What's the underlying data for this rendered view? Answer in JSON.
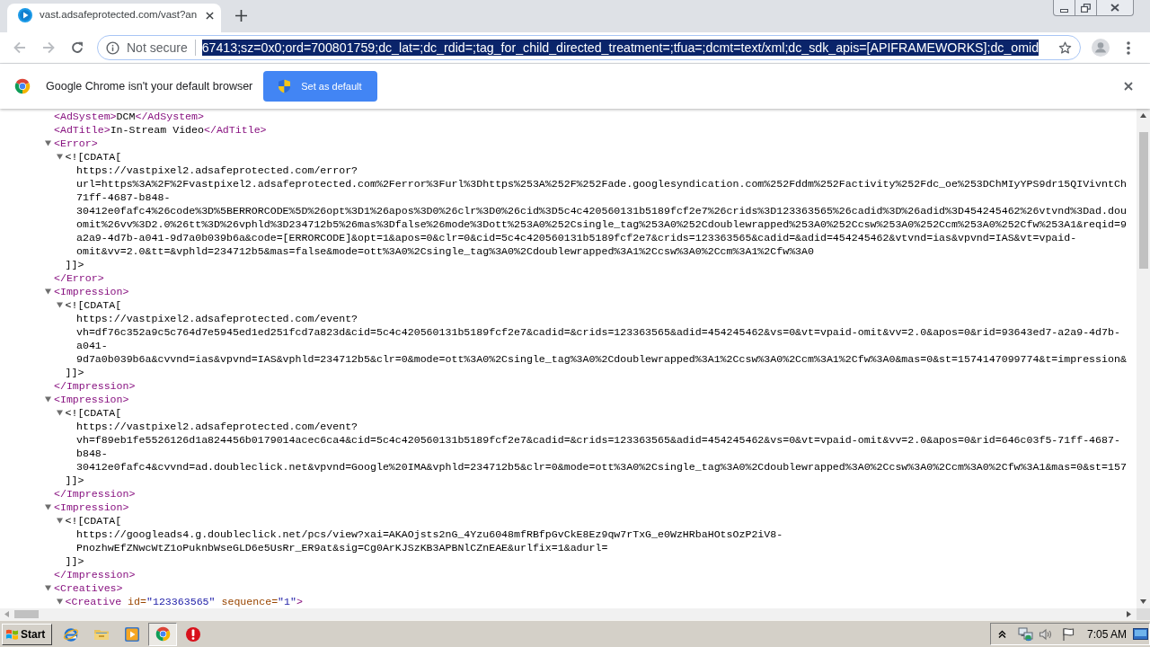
{
  "tabs": [
    {
      "title": "vast.adsafeprotected.com/vast?an",
      "selected": true
    }
  ],
  "toolbar": {
    "nav_buttons": [
      {
        "kind": "back",
        "disabled": true
      },
      {
        "kind": "forward",
        "disabled": true
      },
      {
        "kind": "reload",
        "disabled": false
      }
    ],
    "security_label": "Not secure",
    "address": {
      "value": "67413;sz=0x0;ord=700801759;dc_lat=;dc_rdid=;tag_for_child_directed_treatment=;tfua=;dcmt=text/xml;dc_sdk_apis=[APIFRAMEWORKS];dc_omid",
      "selected": true
    }
  },
  "infobar": {
    "message": "Google Chrome isn't your default browser",
    "button": "Set as default"
  },
  "document": {
    "nodes": [
      {
        "tokens": [
          {
            "kind": "tag",
            "text": "<AdSystem>"
          },
          {
            "kind": "text",
            "text": "DCM"
          },
          {
            "kind": "tag",
            "text": "</AdSystem>"
          }
        ]
      },
      {
        "tokens": [
          {
            "kind": "tag",
            "text": "<AdTitle>"
          },
          {
            "kind": "text",
            "text": "In-Stream Video"
          },
          {
            "kind": "tag",
            "text": "</AdTitle>"
          }
        ]
      },
      {
        "open": [
          {
            "kind": "tag",
            "text": "<Error>"
          }
        ],
        "expanded": true,
        "children": [
          {
            "open": [
              {
                "kind": "text",
                "text": "<![CDATA["
              }
            ],
            "expanded": true,
            "children": [
              {
                "text": "https://vastpixel2.adsafeprotected.com/error?"
              },
              {
                "text": "url=https%3A%2F%2Fvastpixel2.adsafeprotected.com%2Ferror%3Furl%3Dhttps%253A%252F%252Fade.googlesyndication.com%252Fddm%252Factivity%252Fdc_oe%253DChMIyYPS9dr15QIVivntCh"
              },
              {
                "text": "71ff-4687-b848-"
              },
              {
                "text": "30412e0fafc4%26code%3D%5BERRORCODE%5D%26opt%3D1%26apos%3D0%26clr%3D0%26cid%3D5c4c420560131b5189fcf2e7%26crids%3D123363565%26cadid%3D%26adid%3D454245462%26vtvnd%3Dad.dou"
              },
              {
                "text": "omit%26vv%3D2.0%26tt%3D%26vphld%3D234712b5%26mas%3Dfalse%26mode%3Dott%253A0%252Csingle_tag%253A0%252Cdoublewrapped%253A0%252Ccsw%253A0%252Ccm%253A0%252Cfw%253A1&reqid=9"
              },
              {
                "text": "a2a9-4d7b-a041-9d7a0b039b6a&code=[ERRORCODE]&opt=1&apos=0&clr=0&cid=5c4c420560131b5189fcf2e7&crids=123363565&cadid=&adid=454245462&vtvnd=ias&vpvnd=IAS&vt=vpaid-"
              },
              {
                "text": "omit&vv=2.0&tt=&vphld=234712b5&mas=false&mode=ott%3A0%2Csingle_tag%3A0%2Cdoublewrapped%3A1%2Ccsw%3A0%2Ccm%3A1%2Cfw%3A0"
              }
            ],
            "close": [
              {
                "kind": "text",
                "text": "]]>"
              }
            ]
          }
        ],
        "close": [
          {
            "kind": "tag",
            "text": "</Error>"
          }
        ]
      },
      {
        "open": [
          {
            "kind": "tag",
            "text": "<Impression>"
          }
        ],
        "expanded": true,
        "children": [
          {
            "open": [
              {
                "kind": "text",
                "text": "<![CDATA["
              }
            ],
            "expanded": true,
            "children": [
              {
                "text": "https://vastpixel2.adsafeprotected.com/event?"
              },
              {
                "text": "vh=df76c352a9c5c764d7e5945ed1ed251fcd7a823d&cid=5c4c420560131b5189fcf2e7&cadid=&crids=123363565&adid=454245462&vs=0&vt=vpaid-omit&vv=2.0&apos=0&rid=93643ed7-a2a9-4d7b-"
              },
              {
                "text": "a041-"
              },
              {
                "text": "9d7a0b039b6a&cvvnd=ias&vpvnd=IAS&vphld=234712b5&clr=0&mode=ott%3A0%2Csingle_tag%3A0%2Cdoublewrapped%3A1%2Ccsw%3A0%2Ccm%3A1%2Cfw%3A0&mas=0&st=1574147099774&t=impression&"
              }
            ],
            "close": [
              {
                "kind": "text",
                "text": "]]>"
              }
            ]
          }
        ],
        "close": [
          {
            "kind": "tag",
            "text": "</Impression>"
          }
        ]
      },
      {
        "open": [
          {
            "kind": "tag",
            "text": "<Impression>"
          }
        ],
        "expanded": true,
        "children": [
          {
            "open": [
              {
                "kind": "text",
                "text": "<![CDATA["
              }
            ],
            "expanded": true,
            "children": [
              {
                "text": "https://vastpixel2.adsafeprotected.com/event?"
              },
              {
                "text": "vh=f89eb1fe5526126d1a824456b0179014acec6ca4&cid=5c4c420560131b5189fcf2e7&cadid=&crids=123363565&adid=454245462&vs=0&vt=vpaid-omit&vv=2.0&apos=0&rid=646c03f5-71ff-4687-"
              },
              {
                "text": "b848-"
              },
              {
                "text": "30412e0fafc4&cvvnd=ad.doubleclick.net&vpvnd=Google%20IMA&vphld=234712b5&clr=0&mode=ott%3A0%2Csingle_tag%3A0%2Cdoublewrapped%3A0%2Ccsw%3A0%2Ccm%3A0%2Cfw%3A1&mas=0&st=157"
              }
            ],
            "close": [
              {
                "kind": "text",
                "text": "]]>"
              }
            ]
          }
        ],
        "close": [
          {
            "kind": "tag",
            "text": "</Impression>"
          }
        ]
      },
      {
        "open": [
          {
            "kind": "tag",
            "text": "<Impression>"
          }
        ],
        "expanded": true,
        "children": [
          {
            "open": [
              {
                "kind": "text",
                "text": "<![CDATA["
              }
            ],
            "expanded": true,
            "children": [
              {
                "text": "https://googleads4.g.doubleclick.net/pcs/view?xai=AKAOjsts2nG_4Yzu6048mfRBfpGvCkE8Ez9qw7rTxG_e0WzHRbaHOtsOzP2iV8-"
              },
              {
                "text": "PnozhwEfZNwcWtZ1oPuknbWseGLD6e5UsRr_ER9at&sig=Cg0ArKJSzKB3APBNlCZnEAE&urlfix=1&adurl="
              }
            ],
            "close": [
              {
                "kind": "text",
                "text": "]]>"
              }
            ]
          }
        ],
        "close": [
          {
            "kind": "tag",
            "text": "</Impression>"
          }
        ]
      },
      {
        "open": [
          {
            "kind": "tag",
            "text": "<Creatives>"
          }
        ],
        "expanded": true,
        "children": [
          {
            "open": [
              {
                "kind": "tag",
                "text": "<Creative"
              },
              {
                "kind": "attr_name",
                "text": "id="
              },
              {
                "kind": "attr_value",
                "text": "\"123363565\""
              },
              {
                "kind": "attr_name",
                "text": "sequence="
              },
              {
                "kind": "attr_value",
                "text": "\"1\""
              },
              {
                "kind": "tag",
                "text": ">"
              }
            ],
            "expanded": true
          }
        ]
      }
    ]
  },
  "taskbar": {
    "start": "Start",
    "apps": [
      {
        "kind": "globe",
        "selected": false
      },
      {
        "kind": "folder",
        "selected": false
      },
      {
        "kind": "player",
        "selected": false
      },
      {
        "kind": "browser",
        "selected": true
      },
      {
        "kind": "alert",
        "selected": false
      }
    ],
    "clock": "7:05 AM"
  }
}
